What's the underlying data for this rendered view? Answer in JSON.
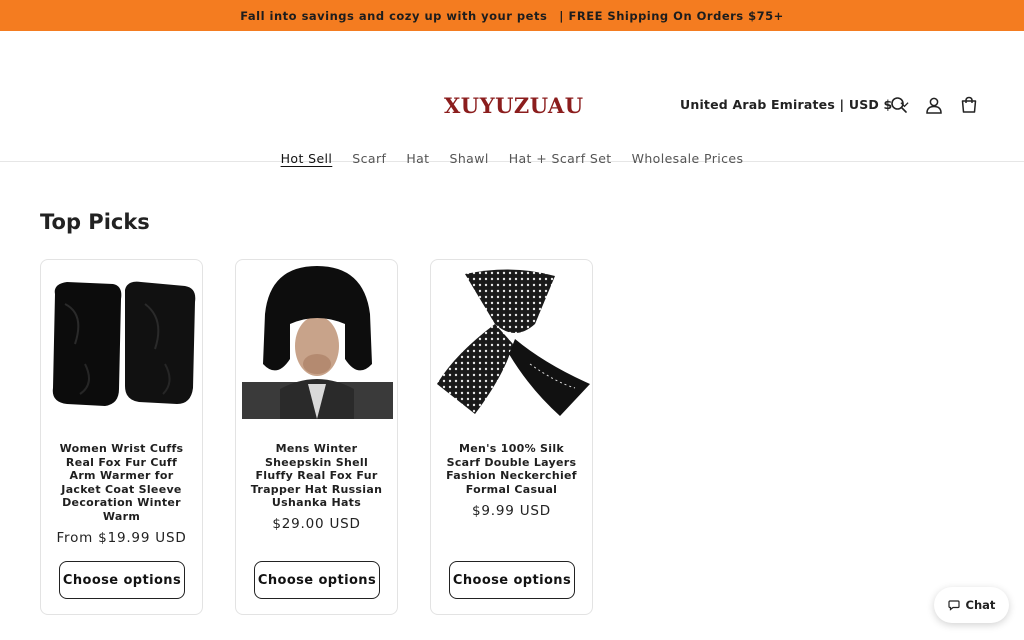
{
  "announcement": {
    "text1": "Fall into savings and cozy up with your pets",
    "text2": "| FREE Shipping On Orders $75+",
    "bg_color": "#f47c20"
  },
  "header": {
    "logo": "XUYUZUAU",
    "logo_color": "#8b1d1d",
    "country_selector": "United Arab Emirates | USD $",
    "icons": [
      "search-icon",
      "account-icon",
      "cart-icon"
    ]
  },
  "nav": {
    "items": [
      {
        "label": "Hot Sell",
        "active": true
      },
      {
        "label": "Scarf"
      },
      {
        "label": "Hat"
      },
      {
        "label": "Shawl"
      },
      {
        "label": "Hat + Scarf Set"
      },
      {
        "label": "Wholesale Prices"
      }
    ]
  },
  "section": {
    "title": "Top Picks"
  },
  "products": [
    {
      "title": "Women Wrist Cuffs Real Fox Fur Cuff Arm Warmer for Jacket Coat Sleeve Decoration Winter Warm",
      "price": "From $19.99 USD",
      "button": "Choose options"
    },
    {
      "title": "Mens Winter Sheepskin Shell Fluffy Real Fox Fur Trapper Hat Russian Ushanka Hats",
      "price": "$29.00 USD",
      "button": "Choose options"
    },
    {
      "title": "Men's 100% Silk Scarf Double Layers Fashion Neckerchief Formal Casual",
      "price": "$9.99 USD",
      "button": "Choose options"
    }
  ],
  "chat": {
    "label": "Chat"
  }
}
